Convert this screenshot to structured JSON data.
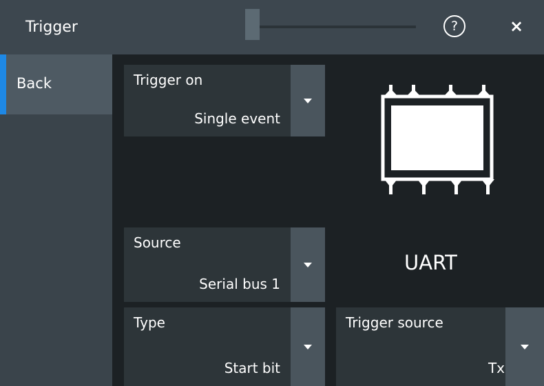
{
  "titlebar": {
    "title": "Trigger",
    "help_icon": "?",
    "close_icon": "×"
  },
  "sidebar": {
    "items": [
      {
        "label": "Back",
        "active": true
      }
    ]
  },
  "fields": {
    "trigger_on": {
      "label": "Trigger on",
      "value": "Single event"
    },
    "source": {
      "label": "Source",
      "value": "Serial bus 1"
    },
    "type": {
      "label": "Type",
      "value": "Start bit"
    },
    "trigger_source": {
      "label": "Trigger source",
      "value": "Tx"
    }
  },
  "protocol": {
    "name": "UART",
    "icon": "ic-chip-icon"
  },
  "colors": {
    "titlebar": "#3d474f",
    "background": "#1c2124",
    "sidebar": "#3a444b",
    "sidebar_active": "#4e5a63",
    "accent": "#1e88e5",
    "field": "#2d3539",
    "dropdown": "#4a555d"
  }
}
